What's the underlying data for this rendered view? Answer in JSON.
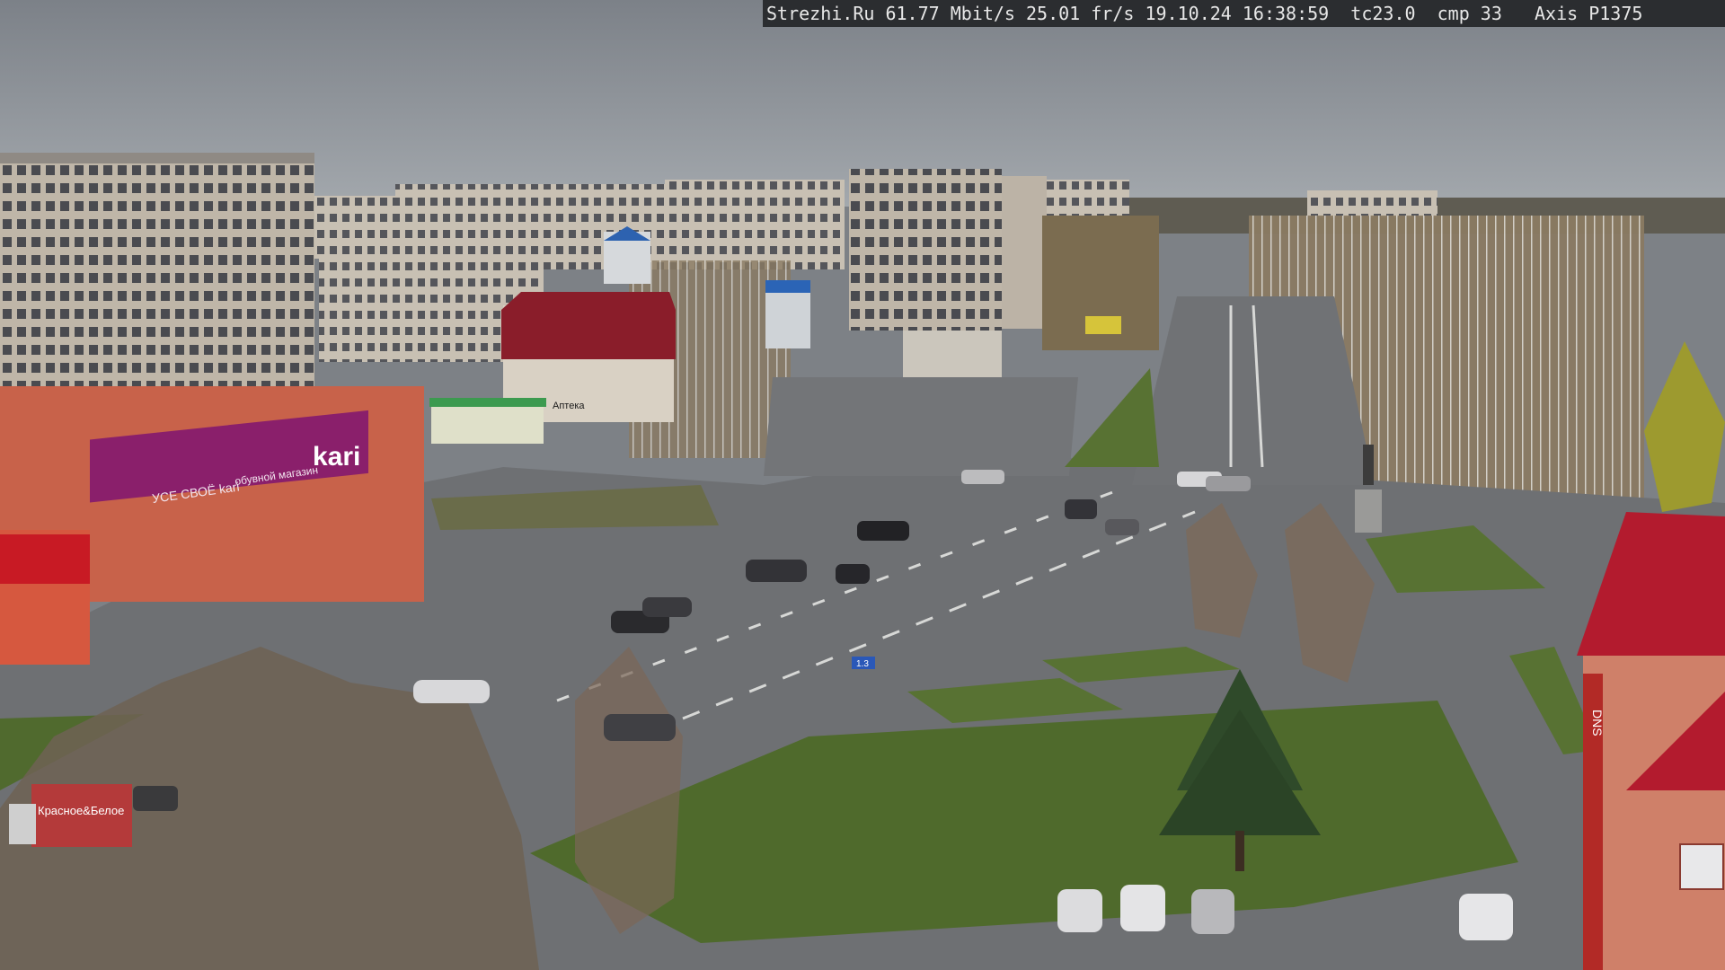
{
  "osd": {
    "site": "Strezhi.Ru",
    "bitrate": "61.77 Mbit/s",
    "framerate": "25.01 fr/s",
    "date": "19.10.24",
    "time": "16:38:59",
    "tc": "tc23.0",
    "cmp": "cmp 33",
    "camera": "Axis P1375"
  },
  "signs": {
    "store_main": "kari",
    "store_banner_1": "УСЕ СВОЁ kari",
    "store_banner_2": "обувной магазин",
    "truck": "Красное&Белое",
    "shop_small": "Аптека",
    "tower_side": "DNS",
    "road_sign": "1.3"
  },
  "colors": {
    "sky": "#8b9096",
    "asphalt": "#6e7073",
    "grass": "#4f6a2c",
    "kari_purple": "#8a1f6b",
    "roof_red": "#b01e2c",
    "brick": "#c8624a"
  }
}
